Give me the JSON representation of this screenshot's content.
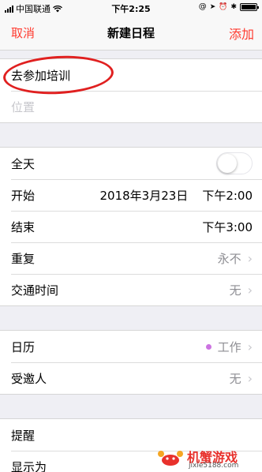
{
  "status_bar": {
    "carrier": "中国联通",
    "time": "下午2:25"
  },
  "nav": {
    "cancel_label": "取消",
    "title": "新建日程",
    "add_label": "添加"
  },
  "event": {
    "title": "去参加培训",
    "location_placeholder": "位置"
  },
  "time_section": {
    "all_day_label": "全天",
    "all_day_on": false,
    "start_label": "开始",
    "start_date": "2018年3月23日",
    "start_time": "下午2:00",
    "end_label": "结束",
    "end_time": "下午3:00",
    "repeat_label": "重复",
    "repeat_value": "永不",
    "travel_label": "交通时间",
    "travel_value": "无"
  },
  "calendar_section": {
    "calendar_label": "日历",
    "calendar_value": "工作",
    "calendar_color": "#cc73e1",
    "invitees_label": "受邀人",
    "invitees_value": "无"
  },
  "alert_section": {
    "alert_label": "提醒",
    "show_as_label": "显示为"
  },
  "watermark": {
    "brand": "机蟹游戏",
    "url": "jixie5188.com"
  },
  "colors": {
    "accent": "#ff3b30",
    "annotation": "#e02020"
  }
}
